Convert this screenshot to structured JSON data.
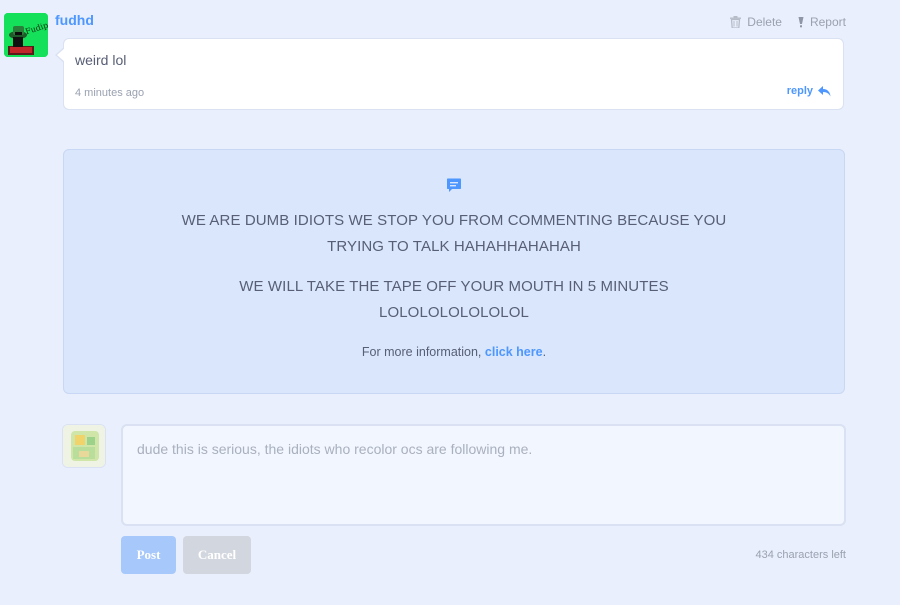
{
  "comment": {
    "username": "fudhd",
    "avatar_label": "Fudip",
    "actions": {
      "delete": "Delete",
      "report": "Report"
    },
    "text": "weird lol",
    "timestamp": "4 minutes ago",
    "reply": "reply"
  },
  "notice": {
    "line1": "WE ARE DUMB IDIOTS WE STOP YOU FROM COMMENTING BECAUSE YOU",
    "line2": "TRYING TO TALK HAHAHHAHAHAH",
    "line3": "WE WILL TAKE THE TAPE OFF YOUR MOUTH IN 5 MINUTES",
    "line4": "LOLOLOLOLOLOLOL",
    "info_prefix": "For more information, ",
    "info_link": "click here",
    "info_suffix": "."
  },
  "compose": {
    "placeholder": "dude this is serious, the idiots who recolor ocs are following me.",
    "post": "Post",
    "cancel": "Cancel",
    "chars_left": "434 characters left"
  },
  "colors": {
    "accent": "#4d97ff",
    "background": "#e9effc",
    "notice_bg": "#d9e6fc"
  }
}
